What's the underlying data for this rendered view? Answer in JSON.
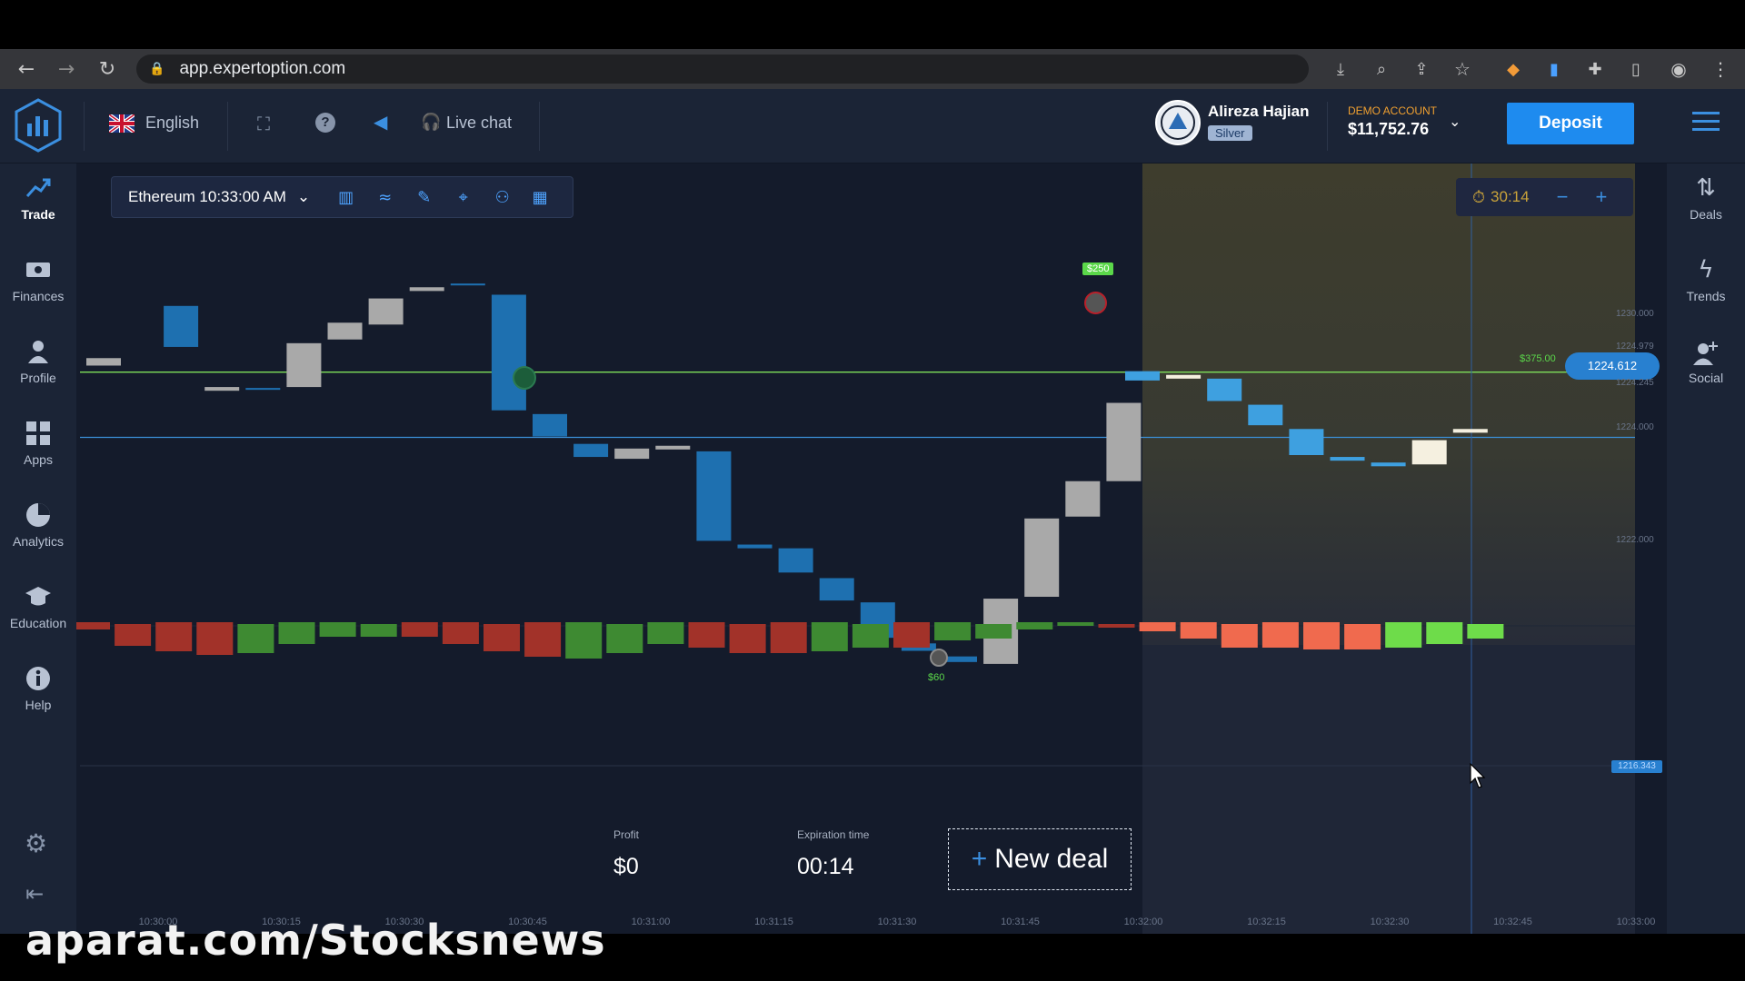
{
  "browser": {
    "url": "app.expertoption.com"
  },
  "header": {
    "language": "English",
    "live_chat": "Live chat",
    "user_name": "Alireza Hajian",
    "user_level": "Silver",
    "account_type": "DEMO ACCOUNT",
    "balance": "$11,752.76",
    "deposit_label": "Deposit"
  },
  "left_nav": [
    {
      "label": "Trade",
      "icon": "trend-icon",
      "active": true
    },
    {
      "label": "Finances",
      "icon": "cash-icon"
    },
    {
      "label": "Profile",
      "icon": "person-icon"
    },
    {
      "label": "Apps",
      "icon": "grid-icon"
    },
    {
      "label": "Analytics",
      "icon": "pie-icon"
    },
    {
      "label": "Education",
      "icon": "graduation-cap-icon"
    },
    {
      "label": "Help",
      "icon": "info-icon"
    }
  ],
  "right_nav": [
    {
      "label": "Deals",
      "icon": "swap-icon"
    },
    {
      "label": "Trends",
      "icon": "lightning-icon"
    },
    {
      "label": "Social",
      "icon": "add-person-icon"
    }
  ],
  "toolbar": {
    "asset": "Ethereum 10:33:00 AM"
  },
  "timer": {
    "value": "30:14"
  },
  "deal": {
    "profit_label": "Profit",
    "profit_value": "$0",
    "expiration_label": "Expiration time",
    "expiration_value": "00:14",
    "new_deal_label": "New deal"
  },
  "markers": {
    "upper_deal": "$250",
    "lower_deal": "$60",
    "price_tag": "1224.612",
    "payout_up": "$375.00",
    "indicator_tag": "1216.343"
  },
  "watermark": "aparat.com/Stocksnews",
  "chart_data": {
    "type": "candlestick",
    "x_ticks": [
      "10:30:00",
      "10:30:15",
      "10:30:30",
      "10:30:45",
      "10:31:00",
      "10:31:15",
      "10:31:30",
      "10:31:45",
      "10:32:00",
      "10:32:15",
      "10:32:30",
      "10:32:45",
      "10:33:00"
    ],
    "y_ticks": [
      "1230.000",
      "1224.979",
      "1224.245",
      "1224.000",
      "1222.000"
    ],
    "current_price": 1224.612,
    "colors": {
      "up": "#a9a9a9",
      "down": "#1e70b0",
      "future_up": "#f5f0e0",
      "future_down": "#3ea0e0",
      "hist_up": "#3e8a32",
      "hist_down": "#a23229",
      "hist_future_up": "#6edc4a",
      "hist_future_down": "#f06a4e",
      "target_line": "#7ee05a",
      "price_line": "#3b8fd8"
    },
    "candles_note": "1-second candles approximated from screenshot",
    "candles": [
      {
        "o": 1227.2,
        "c": 1227.6,
        "dir": "up"
      },
      {
        "o": 1228.2,
        "c": 1230.4,
        "dir": "down"
      },
      {
        "o": 1225.85,
        "c": 1226.05,
        "dir": "up"
      },
      {
        "o": 1226.0,
        "c": 1225.9,
        "dir": "down"
      },
      {
        "o": 1226.05,
        "c": 1228.4,
        "dir": "up"
      },
      {
        "o": 1228.6,
        "c": 1229.5,
        "dir": "up"
      },
      {
        "o": 1229.4,
        "c": 1230.8,
        "dir": "up"
      },
      {
        "o": 1231.2,
        "c": 1231.4,
        "dir": "up"
      },
      {
        "o": 1231.5,
        "c": 1231.6,
        "dir": "down"
      },
      {
        "o": 1231.0,
        "c": 1224.8,
        "dir": "down"
      },
      {
        "o": 1224.6,
        "c": 1223.4,
        "dir": "down"
      },
      {
        "o": 1223.0,
        "c": 1222.3,
        "dir": "down"
      },
      {
        "o": 1222.2,
        "c": 1222.75,
        "dir": "up"
      },
      {
        "o": 1222.7,
        "c": 1222.9,
        "dir": "up"
      },
      {
        "o": 1222.6,
        "c": 1217.8,
        "dir": "down"
      },
      {
        "o": 1217.6,
        "c": 1217.4,
        "dir": "down"
      },
      {
        "o": 1217.4,
        "c": 1216.1,
        "dir": "down"
      },
      {
        "o": 1215.8,
        "c": 1214.6,
        "dir": "down"
      },
      {
        "o": 1214.5,
        "c": 1212.6,
        "dir": "down"
      },
      {
        "o": 1212.3,
        "c": 1211.9,
        "dir": "down"
      },
      {
        "o": 1211.6,
        "c": 1211.3,
        "dir": "down"
      },
      {
        "o": 1211.2,
        "c": 1214.7,
        "dir": "up"
      },
      {
        "o": 1214.8,
        "c": 1219.0,
        "dir": "up"
      },
      {
        "o": 1219.1,
        "c": 1221.0,
        "dir": "up"
      },
      {
        "o": 1221.0,
        "c": 1225.2,
        "dir": "up"
      }
    ],
    "future_candles": [
      {
        "o": 1226.4,
        "c": 1226.9,
        "dir": "down"
      },
      {
        "o": 1226.7,
        "c": 1226.5,
        "dir": "up"
      },
      {
        "o": 1226.5,
        "c": 1225.3,
        "dir": "down"
      },
      {
        "o": 1225.1,
        "c": 1224.0,
        "dir": "down"
      },
      {
        "o": 1223.8,
        "c": 1222.4,
        "dir": "down"
      },
      {
        "o": 1222.3,
        "c": 1222.1,
        "dir": "down"
      },
      {
        "o": 1222.0,
        "c": 1221.8,
        "dir": "down"
      },
      {
        "o": 1221.9,
        "c": 1223.2,
        "dir": "up"
      },
      {
        "o": 1223.6,
        "c": 1223.8,
        "dir": "up"
      }
    ],
    "histogram": [
      {
        "v": -0.4
      },
      {
        "v": -1.2
      },
      {
        "v": -1.6
      },
      {
        "v": -1.8
      },
      {
        "v": 1.6
      },
      {
        "v": 1.2
      },
      {
        "v": 0.8
      },
      {
        "v": 0.7
      },
      {
        "v": -0.8
      },
      {
        "v": -1.2
      },
      {
        "v": -1.5
      },
      {
        "v": -1.9
      },
      {
        "v": 2.0
      },
      {
        "v": 1.6
      },
      {
        "v": 1.2
      },
      {
        "v": -1.4
      },
      {
        "v": -1.6
      },
      {
        "v": -1.7
      },
      {
        "v": 1.6
      },
      {
        "v": 1.3
      },
      {
        "v": -1.4
      },
      {
        "v": 1.0
      },
      {
        "v": 0.8
      },
      {
        "v": 0.4
      },
      {
        "v": 0.2
      },
      {
        "v": -0.2
      },
      {
        "v": -0.5,
        "f": true
      },
      {
        "v": -0.9,
        "f": true
      },
      {
        "v": -1.3,
        "f": true
      },
      {
        "v": -1.4,
        "f": true
      },
      {
        "v": -1.5,
        "f": true
      },
      {
        "v": -1.4,
        "f": true
      },
      {
        "v": 1.4,
        "f": true
      },
      {
        "v": 1.2,
        "f": true
      },
      {
        "v": 0.8,
        "f": true
      }
    ]
  }
}
